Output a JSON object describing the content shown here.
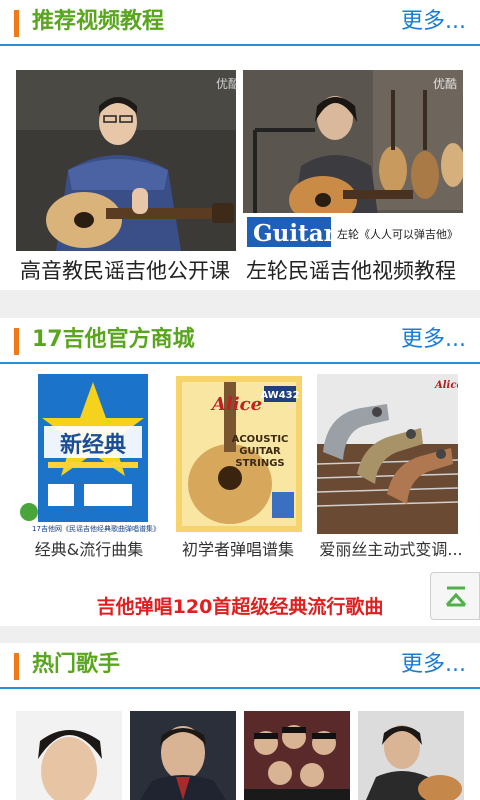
{
  "sections": {
    "recommended_videos": {
      "title": "推荐视频教程",
      "more": "更多...",
      "items": [
        {
          "caption": "高音教民谣吉他公开课",
          "watermark": "优酷"
        },
        {
          "caption": "左轮民谣吉他视频教程",
          "watermark": "优酷",
          "banner_word": "Guitar",
          "banner_text": "左轮《人人可以弹吉他》"
        }
      ]
    },
    "official_store": {
      "title": "17吉他官方商城",
      "more": "更多...",
      "items": [
        {
          "caption": "经典&流行曲集",
          "cover_title": "新经典",
          "cover_footer": "17吉他网《民谣吉他经典歌曲弹唱谱集》"
        },
        {
          "caption": "初学者弹唱谱集",
          "brand": "Alice",
          "model": "AW432",
          "pack_line1": "ACOUSTIC",
          "pack_line2": "GUITAR",
          "pack_line3": "STRINGS"
        },
        {
          "caption": "爱丽丝主动式变调...",
          "brand": "Alice"
        }
      ],
      "promo_text": "吉他弹唱120首超级经典流行歌曲"
    },
    "hot_singers": {
      "title": "热门歌手",
      "more": "更多..."
    }
  },
  "colors": {
    "accent_orange": "#f07a1a",
    "title_green": "#59a61e",
    "link_blue": "#1a7dd4",
    "divider_blue": "#2a8fd8",
    "promo_red": "#e02020"
  },
  "icons": {
    "scroll_top": "arrow-up-to-line-icon"
  }
}
